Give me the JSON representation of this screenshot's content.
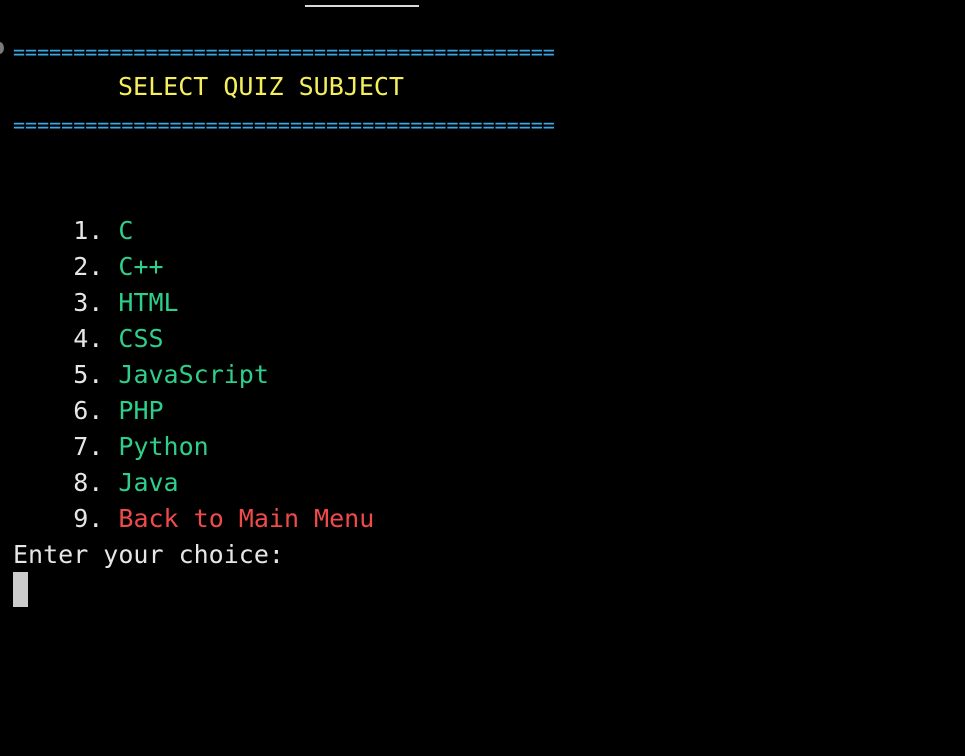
{
  "header": {
    "rule_top": "=============================================",
    "title": "SELECT QUIZ SUBJECT",
    "rule_bottom": "============================================="
  },
  "menu": {
    "items": [
      {
        "number": "1.",
        "label": "C"
      },
      {
        "number": "2.",
        "label": "C++"
      },
      {
        "number": "3.",
        "label": "HTML"
      },
      {
        "number": "4.",
        "label": "CSS"
      },
      {
        "number": "5.",
        "label": "JavaScript"
      },
      {
        "number": "6.",
        "label": "PHP"
      },
      {
        "number": "7.",
        "label": "Python"
      },
      {
        "number": "8.",
        "label": "Java"
      },
      {
        "number": "9.",
        "label": "Back to Main Menu"
      }
    ]
  },
  "prompt": {
    "text": "Enter your choice:"
  },
  "colors": {
    "background": "#000000",
    "rule": "#3aa7e6",
    "title": "#f5f05a",
    "option": "#2ecf8a",
    "back_option": "#f04a4a",
    "text": "#e6e6e6",
    "cursor": "#cccccc"
  }
}
